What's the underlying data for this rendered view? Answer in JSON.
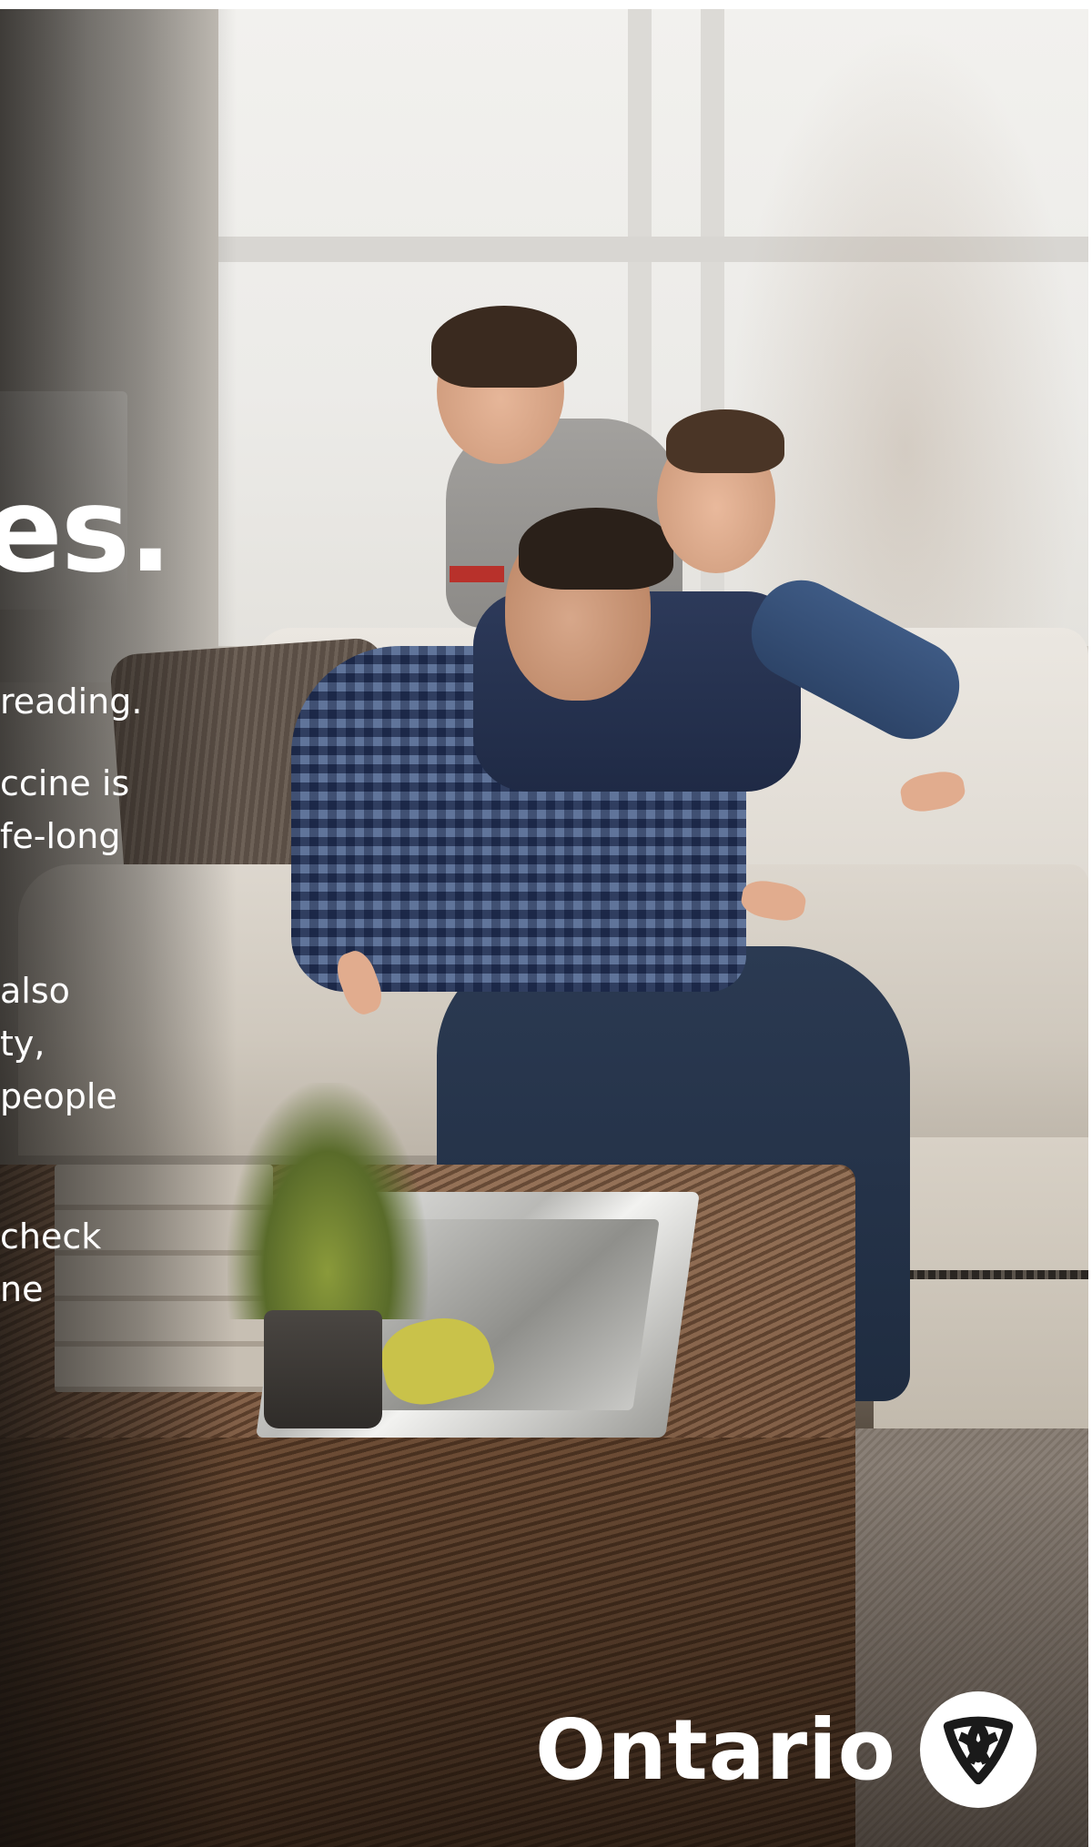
{
  "headline": {
    "fragment": "es."
  },
  "body": {
    "paragraph1": [
      "reading."
    ],
    "paragraph2": [
      "ccine is",
      "fe-long"
    ],
    "paragraph3": [
      "also",
      "ty,",
      "people"
    ],
    "paragraph4": [
      "check",
      "ne"
    ]
  },
  "brand": {
    "wordmark": "Ontario",
    "logo_icon": "trillium-logo-icon"
  },
  "colors": {
    "text": "#ffffff",
    "logo_background": "#ffffff",
    "logo_foreground": "#1a1a1a"
  }
}
